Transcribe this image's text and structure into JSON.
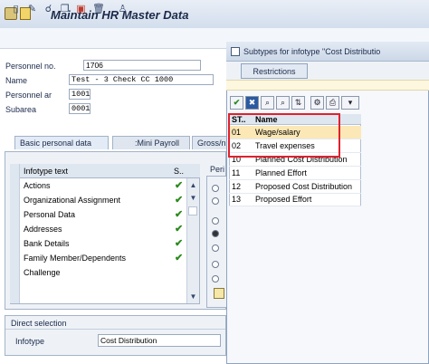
{
  "window": {
    "title": "Maintain HR Master Data"
  },
  "toolbar": {
    "icons": [
      "new-icon",
      "edit-icon",
      "display-icon",
      "copy-icon",
      "delimit-icon",
      "delete-icon",
      "person-icon"
    ]
  },
  "header": {
    "personnel_no_label": "Personnel no.",
    "personnel_no_value": "1706",
    "name_label": "Name",
    "name_value": "Test - 3 Check CC 1000",
    "personnel_area_label": "Personnel ar",
    "personnel_area_value": "1001",
    "subarea_label": "Subarea",
    "subarea_value": "0001"
  },
  "tabs": [
    {
      "label": "Basic personal data"
    },
    {
      "label": ":Mini Payroll"
    },
    {
      "label": "Gross/n"
    }
  ],
  "infotype_table": {
    "col_text": "Infotype text",
    "col_status": "S..",
    "rows": [
      {
        "text": "Actions",
        "check": "✔"
      },
      {
        "text": "Organizational Assignment",
        "check": "✔"
      },
      {
        "text": "Personal Data",
        "check": "✔"
      },
      {
        "text": "Addresses",
        "check": "✔"
      },
      {
        "text": "Bank Details",
        "check": "✔"
      },
      {
        "text": "Family Member/Dependents",
        "check": "✔"
      },
      {
        "text": "Challenge",
        "check": ""
      }
    ]
  },
  "period": {
    "label": "Peri"
  },
  "direct_selection": {
    "label": "Direct selection",
    "infotype_label": "Infotype",
    "infotype_value": "Cost Distribution"
  },
  "popup": {
    "title": "Subtypes for infotype \"Cost Distributio",
    "tab_label": "Restrictions",
    "col_st": "ST..",
    "col_name": "Name",
    "rows": [
      {
        "st": "01",
        "name": "Wage/salary"
      },
      {
        "st": "02",
        "name": "Travel expenses"
      },
      {
        "st": "10",
        "name": "Planned Cost Distribution"
      },
      {
        "st": "11",
        "name": "Planned Effort"
      },
      {
        "st": "12",
        "name": "Proposed Cost Distribution"
      },
      {
        "st": "13",
        "name": "Proposed  Effort"
      }
    ]
  },
  "colors": {
    "highlight_box": "#e0202e",
    "selected_row": "#fbe8b6",
    "check": "#2c8a1d"
  }
}
